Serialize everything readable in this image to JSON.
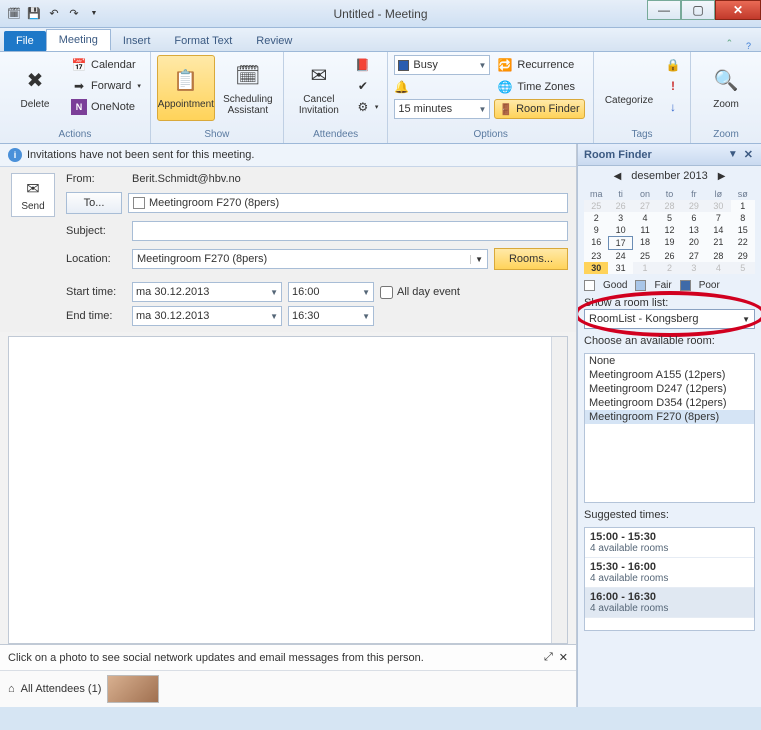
{
  "window": {
    "title": "Untitled - Meeting"
  },
  "tabs": {
    "file": "File",
    "meeting": "Meeting",
    "insert": "Insert",
    "format": "Format Text",
    "review": "Review"
  },
  "ribbon": {
    "actions": {
      "title": "Actions",
      "delete": "Delete",
      "calendar": "Calendar",
      "forward": "Forward",
      "onenote": "OneNote"
    },
    "show": {
      "title": "Show",
      "appointment": "Appointment",
      "scheduling": "Scheduling\nAssistant"
    },
    "attendees": {
      "title": "Attendees",
      "cancel": "Cancel\nInvitation"
    },
    "options": {
      "title": "Options",
      "busy": "Busy",
      "reminder": "15 minutes",
      "recurrence": "Recurrence",
      "timezones": "Time Zones",
      "roomfinder": "Room Finder"
    },
    "tags": {
      "title": "Tags",
      "categorize": "Categorize"
    },
    "zoom": {
      "title": "Zoom",
      "zoom": "Zoom"
    }
  },
  "infobar": "Invitations have not been sent for this meeting.",
  "form": {
    "send": "Send",
    "from_lbl": "From:",
    "from": "Berit.Schmidt@hbv.no",
    "to_btn": "To...",
    "to": "Meetingroom F270 (8pers)",
    "subject_lbl": "Subject:",
    "subject": "",
    "location_lbl": "Location:",
    "location": "Meetingroom F270 (8pers)",
    "rooms_btn": "Rooms...",
    "start_lbl": "Start time:",
    "start_date": "ma 30.12.2013",
    "start_time": "16:00",
    "end_lbl": "End time:",
    "end_date": "ma 30.12.2013",
    "end_time": "16:30",
    "allday": "All day event"
  },
  "social": {
    "text": "Click on a photo to see social network updates and email messages from this person.",
    "attendees": "All Attendees (1)"
  },
  "roomfinder": {
    "title": "Room Finder",
    "month": "desember 2013",
    "dow": [
      "ma",
      "ti",
      "on",
      "to",
      "fr",
      "lø",
      "sø"
    ],
    "legend": {
      "good": "Good",
      "fair": "Fair",
      "poor": "Poor",
      "good_c": "#ffffff",
      "fair_c": "#a9c6e8",
      "poor_c": "#3e6aa8"
    },
    "showlist_lbl": "Show a room list:",
    "roomlist": "RoomList - Kongsberg",
    "choose_lbl": "Choose an available room:",
    "rooms": [
      "None",
      "Meetingroom A155 (12pers)",
      "Meetingroom D247 (12pers)",
      "Meetingroom D354 (12pers)",
      "Meetingroom F270 (8pers)"
    ],
    "selected_room_idx": 4,
    "suggest_lbl": "Suggested times:",
    "slots": [
      {
        "t": "15:00 - 15:30",
        "a": "4 available rooms"
      },
      {
        "t": "15:30 - 16:00",
        "a": "4 available rooms"
      },
      {
        "t": "16:00 - 16:30",
        "a": "4 available rooms"
      }
    ],
    "selected_slot_idx": 2
  },
  "calendar": {
    "prev_trail": [
      25,
      26,
      27,
      28,
      29,
      30
    ],
    "days": [
      1,
      2,
      3,
      4,
      5,
      6,
      7,
      8,
      9,
      10,
      11,
      12,
      13,
      14,
      15,
      16,
      17,
      18,
      19,
      20,
      21,
      22,
      23,
      24,
      25,
      26,
      27,
      28,
      29,
      30,
      31
    ],
    "next_lead": [
      1,
      2,
      3,
      4,
      5
    ],
    "today": 30,
    "selected": 17
  }
}
